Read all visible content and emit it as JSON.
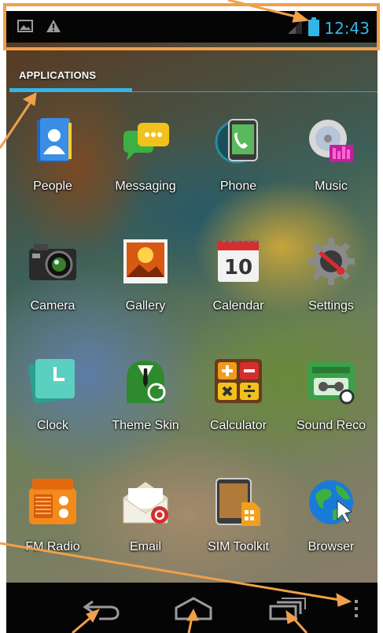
{
  "status_bar": {
    "time": "12:43",
    "left_icons": [
      "image-icon",
      "warning-icon"
    ],
    "right_icons": [
      "signal-icon",
      "battery-icon"
    ]
  },
  "app_drawer": {
    "tab_label": "APPLICATIONS",
    "apps": [
      {
        "label": "People",
        "icon": "people-icon"
      },
      {
        "label": "Messaging",
        "icon": "messaging-icon"
      },
      {
        "label": "Phone",
        "icon": "phone-icon"
      },
      {
        "label": "Music",
        "icon": "music-icon"
      },
      {
        "label": "Camera",
        "icon": "camera-icon"
      },
      {
        "label": "Gallery",
        "icon": "gallery-icon"
      },
      {
        "label": "Calendar",
        "icon": "calendar-icon"
      },
      {
        "label": "Settings",
        "icon": "settings-icon"
      },
      {
        "label": "Clock",
        "icon": "clock-icon"
      },
      {
        "label": "Theme Skin",
        "icon": "theme-skin-icon"
      },
      {
        "label": "Calculator",
        "icon": "calculator-icon"
      },
      {
        "label": "Sound Reco",
        "icon": "sound-recorder-icon"
      },
      {
        "label": "FM Radio",
        "icon": "fm-radio-icon"
      },
      {
        "label": "Email",
        "icon": "email-icon"
      },
      {
        "label": "SIM Toolkit",
        "icon": "sim-toolkit-icon"
      },
      {
        "label": "Browser",
        "icon": "browser-icon"
      }
    ],
    "calendar_day": "10"
  },
  "nav_bar": {
    "buttons": [
      "back-icon",
      "home-icon",
      "recent-apps-icon",
      "menu-icon"
    ]
  },
  "colors": {
    "accent": "#33b5e5",
    "annotation": "#f0a04b",
    "status_bar_bg": "#050505"
  }
}
